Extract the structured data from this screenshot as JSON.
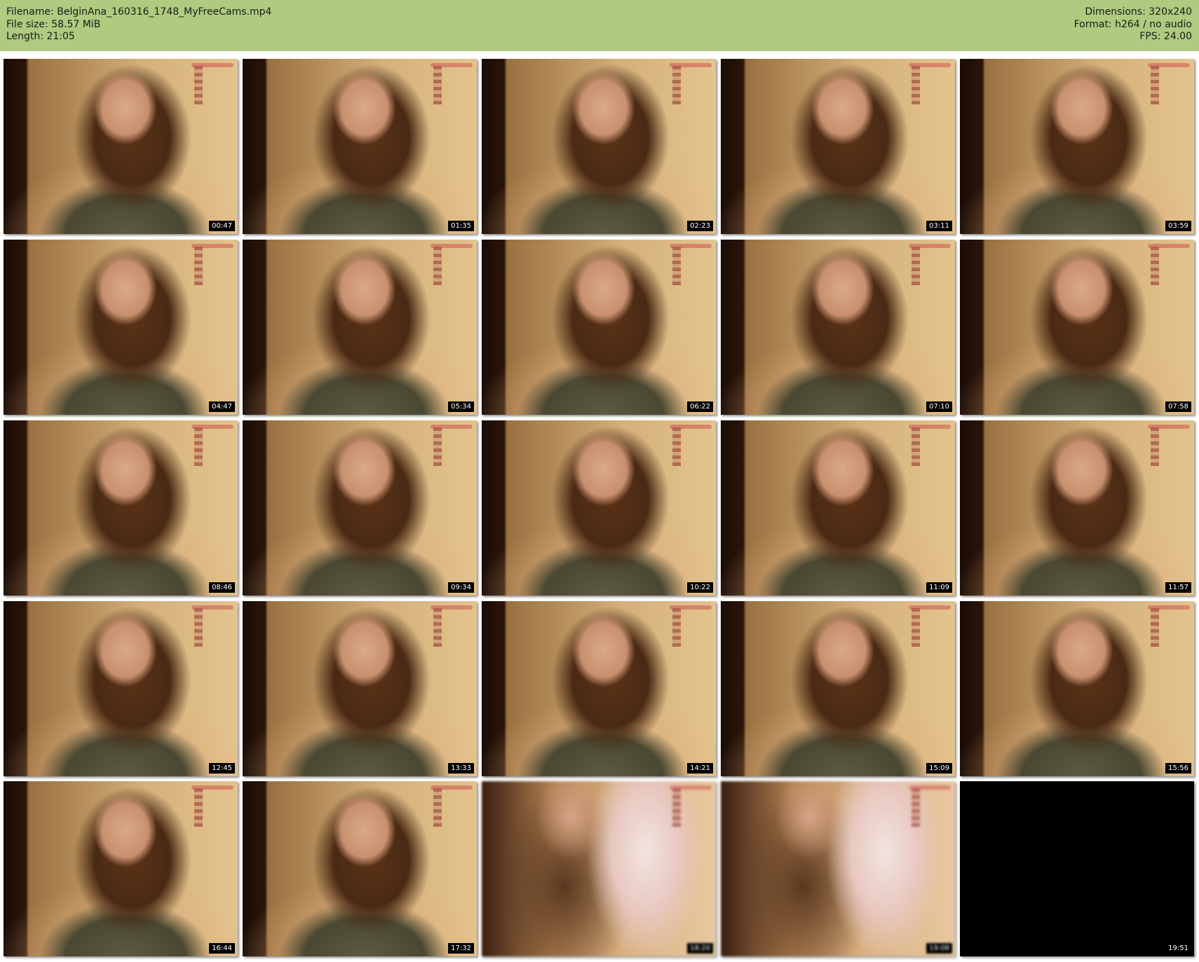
{
  "header": {
    "filename": "Filename: BelginAna_160316_1748_MyFreeCams.mp4",
    "file_size": "File size: 58.57 MiB",
    "length": "Length: 21:05",
    "dimensions": "Dimensions: 320x240",
    "format": "Format: h264 / no audio",
    "fps": "FPS: 24.00",
    "background_color": "#aecb7f"
  },
  "thumbnails": [
    {
      "timestamp": "00:47",
      "style": "normal"
    },
    {
      "timestamp": "01:35",
      "style": "normal"
    },
    {
      "timestamp": "02:23",
      "style": "normal"
    },
    {
      "timestamp": "03:11",
      "style": "normal"
    },
    {
      "timestamp": "03:59",
      "style": "normal"
    },
    {
      "timestamp": "04:47",
      "style": "normal"
    },
    {
      "timestamp": "05:34",
      "style": "normal"
    },
    {
      "timestamp": "06:22",
      "style": "normal"
    },
    {
      "timestamp": "07:10",
      "style": "normal"
    },
    {
      "timestamp": "07:58",
      "style": "normal"
    },
    {
      "timestamp": "08:46",
      "style": "normal"
    },
    {
      "timestamp": "09:34",
      "style": "normal"
    },
    {
      "timestamp": "10:22",
      "style": "normal"
    },
    {
      "timestamp": "11:09",
      "style": "normal"
    },
    {
      "timestamp": "11:57",
      "style": "normal"
    },
    {
      "timestamp": "12:45",
      "style": "normal"
    },
    {
      "timestamp": "13:33",
      "style": "normal"
    },
    {
      "timestamp": "14:21",
      "style": "normal"
    },
    {
      "timestamp": "15:09",
      "style": "normal"
    },
    {
      "timestamp": "15:56",
      "style": "normal"
    },
    {
      "timestamp": "16:44",
      "style": "normal"
    },
    {
      "timestamp": "17:32",
      "style": "normal"
    },
    {
      "timestamp": "18:20",
      "style": "blurred"
    },
    {
      "timestamp": "19:08",
      "style": "blurred"
    },
    {
      "timestamp": "19:51",
      "style": "black"
    }
  ]
}
